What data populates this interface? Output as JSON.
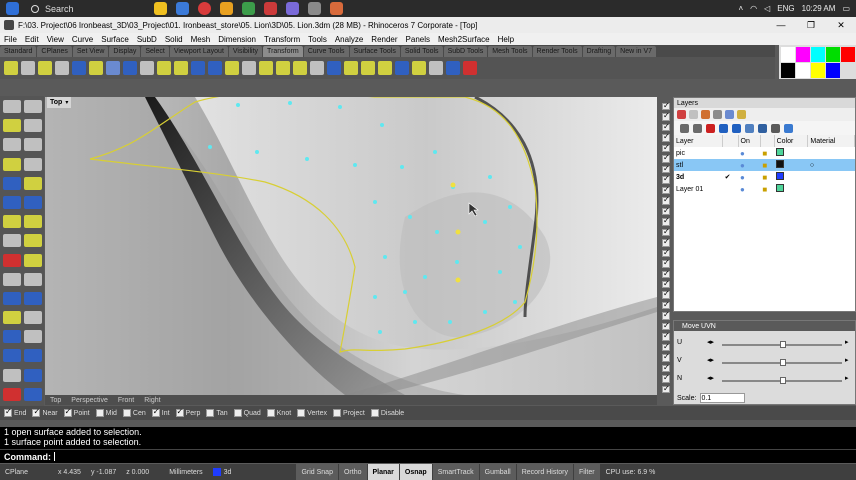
{
  "taskbar": {
    "search_label": "Search",
    "lang": "ENG",
    "clock": "10:29 AM"
  },
  "window": {
    "title": "F:\\03. Project\\06 Ironbeast_3D\\03_Project\\01. Ironbeast_store\\05. Lion\\3D\\05. Lion.3dm (28 MB) - Rhinoceros 7 Corporate - [Top]",
    "minimize": "—",
    "maximize": "❐",
    "close": "✕"
  },
  "menu": [
    "File",
    "Edit",
    "View",
    "Curve",
    "Surface",
    "SubD",
    "Solid",
    "Mesh",
    "Dimension",
    "Transform",
    "Tools",
    "Analyze",
    "Render",
    "Panels",
    "Mesh2Surface",
    "Help"
  ],
  "toolbar_tabs": [
    "Standard",
    "CPlanes",
    "Set View",
    "Display",
    "Select",
    "Viewport Layout",
    "Visibility",
    "Transform",
    "Curve Tools",
    "Surface Tools",
    "Solid Tools",
    "SubD Tools",
    "Mesh Tools",
    "Render Tools",
    "Drafting",
    "New in V7"
  ],
  "active_tab_index": 7,
  "viewport": {
    "name": "Top",
    "tabs": [
      "Top",
      "Perspective",
      "Front",
      "Right"
    ]
  },
  "osnaps": [
    {
      "label": "End",
      "on": true
    },
    {
      "label": "Near",
      "on": true
    },
    {
      "label": "Point",
      "on": true
    },
    {
      "label": "Mid",
      "on": false
    },
    {
      "label": "Cen",
      "on": false
    },
    {
      "label": "Int",
      "on": true
    },
    {
      "label": "Perp",
      "on": true
    },
    {
      "label": "Tan",
      "on": false
    },
    {
      "label": "Quad",
      "on": false
    },
    {
      "label": "Knot",
      "on": false
    },
    {
      "label": "Vertex",
      "on": false
    },
    {
      "label": "Project",
      "on": false
    },
    {
      "label": "Disable",
      "on": false
    }
  ],
  "command": {
    "history": [
      "1 open surface added to selection.",
      "1 surface point added to selection."
    ],
    "prompt": "Command:"
  },
  "status": {
    "cplane": "CPlane",
    "x": "x 4.435",
    "y": "y -1.087",
    "z": "z 0.000",
    "units": "Millimeters",
    "layer": "3d",
    "toggles": [
      {
        "label": "Grid Snap",
        "on": false
      },
      {
        "label": "Ortho",
        "on": false
      },
      {
        "label": "Planar",
        "on": true
      },
      {
        "label": "Osnap",
        "on": true
      },
      {
        "label": "SmartTrack",
        "on": false
      },
      {
        "label": "Gumball",
        "on": false
      },
      {
        "label": "Record History",
        "on": false
      },
      {
        "label": "Filter",
        "on": false
      }
    ],
    "cpu": "CPU use: 6.9 %"
  },
  "layers_panel": {
    "title": "Layers",
    "columns": [
      "Layer",
      "",
      "On",
      "",
      "Color",
      "Material"
    ],
    "rows": [
      {
        "name": "pic",
        "color": "#4fd49a",
        "current": false,
        "selected": false,
        "bold": false
      },
      {
        "name": "stl",
        "color": "#111111",
        "current": false,
        "selected": true,
        "bold": false
      },
      {
        "name": "3d",
        "color": "#1f3cff",
        "current": true,
        "selected": false,
        "bold": true
      },
      {
        "name": "Layer 01",
        "color": "#4fd49a",
        "current": false,
        "selected": false,
        "bold": false
      }
    ]
  },
  "move_panel": {
    "title": "Move UVN",
    "axes": [
      "U",
      "V",
      "N"
    ],
    "scale_label": "Scale:",
    "scale_value": "0.1"
  },
  "colors": {
    "accent": "#89c7f5",
    "curve": "#d8cf34",
    "points": "#5fe8f0"
  }
}
